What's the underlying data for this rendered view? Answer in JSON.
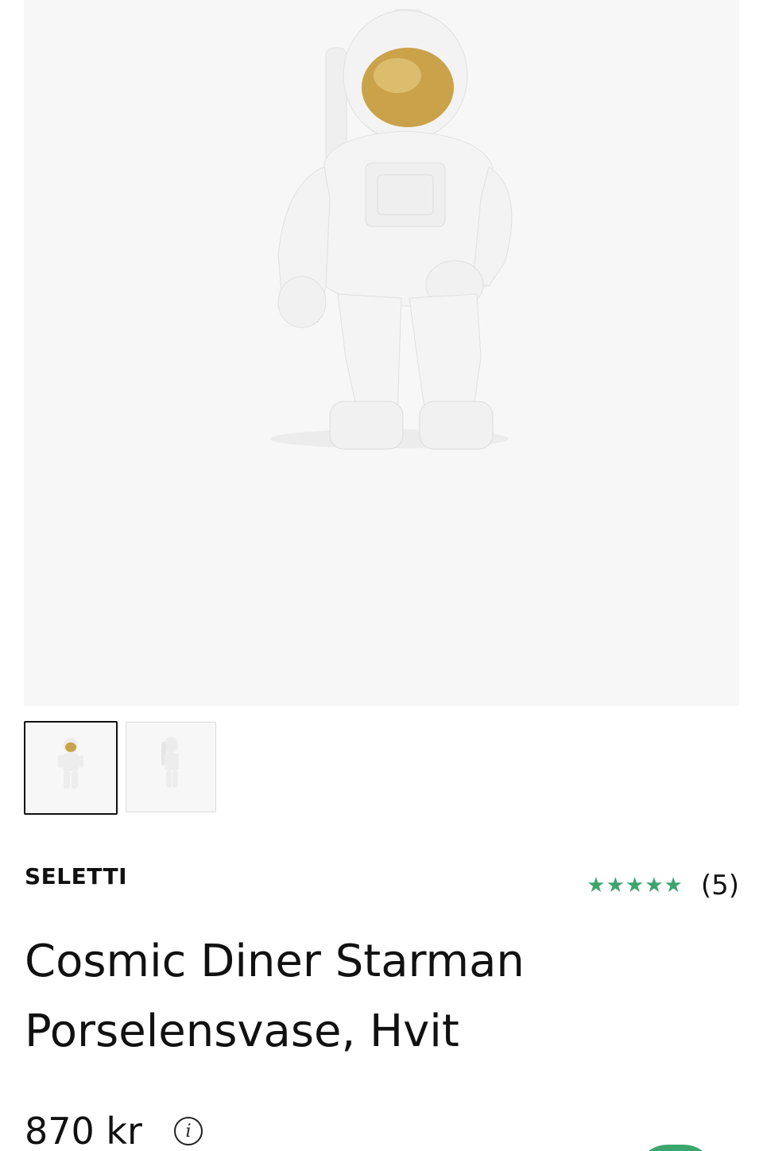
{
  "product": {
    "brand": "SELETTI",
    "title_line1": "Cosmic Diner Starman",
    "title_line2": "Porselensvase, Hvit",
    "rating_stars": "★★★★★",
    "rating_value": 5,
    "review_count": "(5)",
    "price": "870 kr",
    "info_glyph": "i"
  },
  "gallery": {
    "main_image_icon": "astronaut-vase-image",
    "thumbnails": [
      {
        "icon": "astronaut-front-thumbnail",
        "active": true
      },
      {
        "icon": "astronaut-side-thumbnail",
        "active": false
      }
    ]
  },
  "colors": {
    "star_green": "#3aa66e",
    "visor_gold": "#c9a24a",
    "image_bg": "#f7f7f7"
  }
}
